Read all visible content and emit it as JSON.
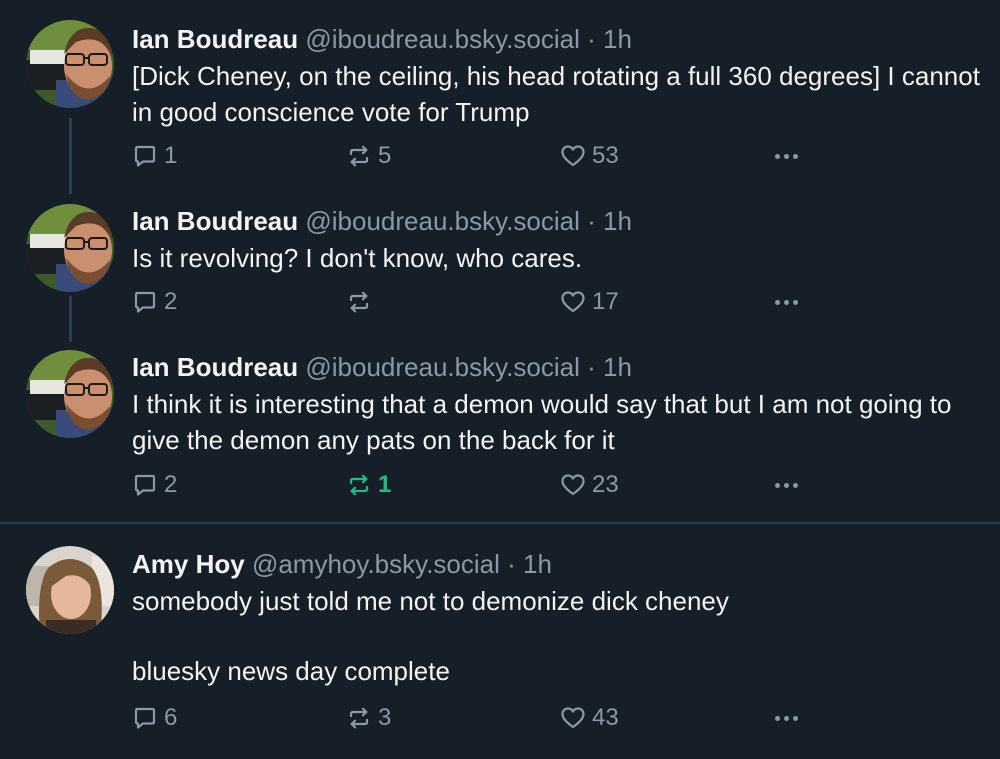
{
  "posts": [
    {
      "author": "Ian Boudreau",
      "handle": "@iboudreau.bsky.social",
      "separator": "·",
      "time": "1h",
      "text": "[Dick Cheney, on the ceiling, his head rotating a full 360 degrees] I cannot in good conscience vote for Trump",
      "replies": "1",
      "reposts": "5",
      "likes": "53"
    },
    {
      "author": "Ian Boudreau",
      "handle": "@iboudreau.bsky.social",
      "separator": "·",
      "time": "1h",
      "text": "Is it revolving? I don't know, who cares.",
      "replies": "2",
      "reposts": "",
      "likes": "17"
    },
    {
      "author": "Ian Boudreau",
      "handle": "@iboudreau.bsky.social",
      "separator": "·",
      "time": "1h",
      "text": "I think it is interesting that a demon would say that but I am not going to give the demon any pats on the back for it",
      "replies": "2",
      "reposts": "1",
      "likes": "23"
    },
    {
      "author": "Amy Hoy",
      "handle": "@amyhoy.bsky.social",
      "separator": "·",
      "time": "1h",
      "text_line1": "somebody just told me not to demonize dick cheney",
      "text_line2": "bluesky news day complete",
      "replies": "6",
      "reposts": "3",
      "likes": "43"
    }
  ],
  "icons": {
    "reply": "speech-bubble-icon",
    "repost": "repost-arrows-icon",
    "like": "heart-icon",
    "more": "ellipsis-icon"
  },
  "colors": {
    "background": "#161e27",
    "muted": "#8b98a5",
    "repost_active": "#20bc81",
    "divider": "#2e3d4e"
  }
}
